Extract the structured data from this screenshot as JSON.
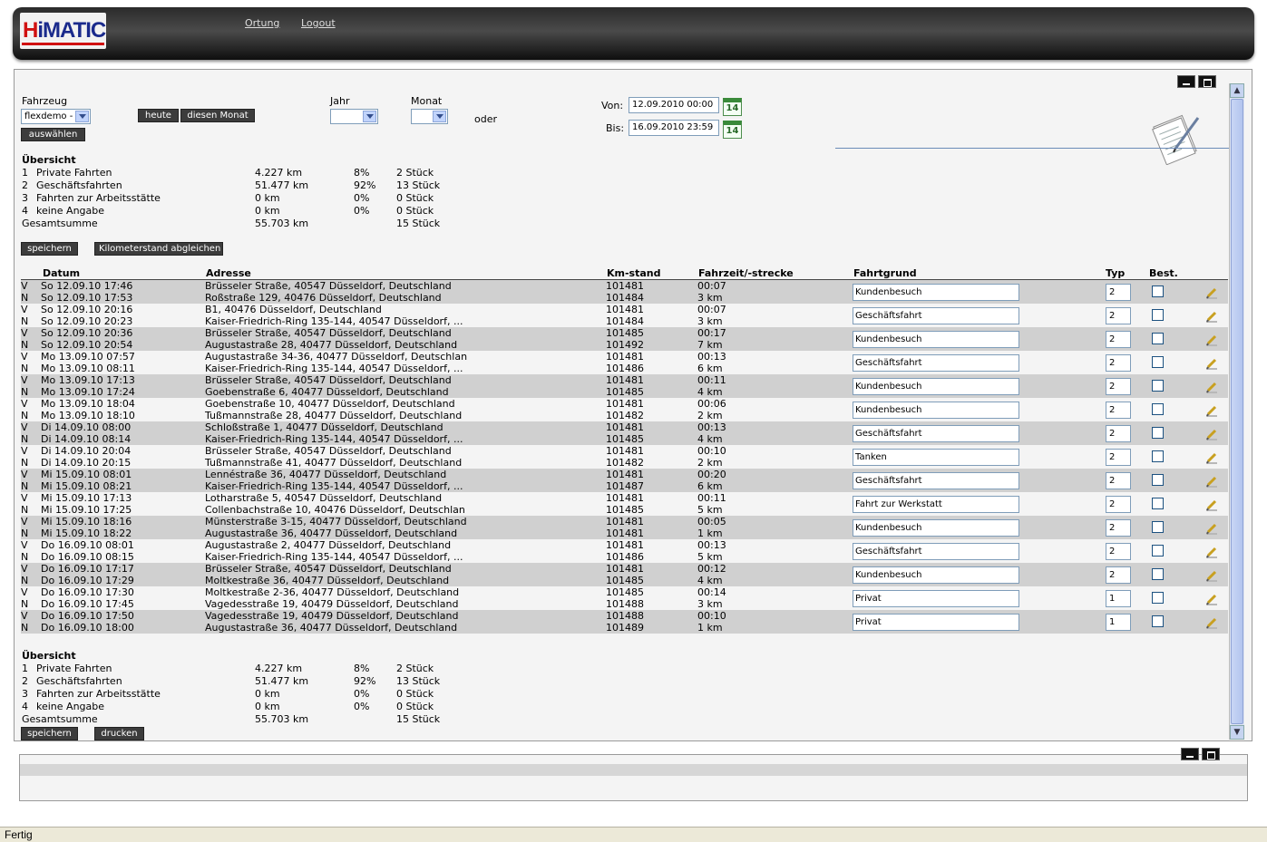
{
  "header": {
    "logo_text": "HiMATIC",
    "nav": [
      "Ortung",
      "Logout"
    ]
  },
  "filter": {
    "fahrzeug_label": "Fahrzeug",
    "fahrzeug_value": "flexdemo -",
    "auswaehlen": "auswählen",
    "heute": "heute",
    "diesen_monat": "diesen Monat",
    "jahr_label": "Jahr",
    "monat_label": "Monat",
    "oder": "oder",
    "von_label": "Von:",
    "von_value": "12.09.2010 00:00",
    "bis_label": "Bis:",
    "bis_value": "16.09.2010 23:59",
    "calendar_day": "14"
  },
  "overview": {
    "title": "Übersicht",
    "rows": [
      {
        "nr": "1",
        "name": "Private Fahrten",
        "km": "4.227 km",
        "pct": "8%",
        "count": "2 Stück"
      },
      {
        "nr": "2",
        "name": "Geschäftsfahrten",
        "km": "51.477 km",
        "pct": "92%",
        "count": "13 Stück"
      },
      {
        "nr": "3",
        "name": "Fahrten zur Arbeitsstätte",
        "km": "0 km",
        "pct": "0%",
        "count": "0 Stück"
      },
      {
        "nr": "4",
        "name": "keine Angabe",
        "km": "0 km",
        "pct": "0%",
        "count": "0 Stück"
      }
    ],
    "total_label": "Gesamtsumme",
    "total_km": "55.703 km",
    "total_count": "15 Stück"
  },
  "buttons": {
    "speichern": "speichern",
    "km_abgleichen": "Kilometerstand abgleichen",
    "drucken": "drucken"
  },
  "table": {
    "headers": {
      "datum": "Datum",
      "adresse": "Adresse",
      "kmstand": "Km-stand",
      "fahrzeit": "Fahrzeit/-strecke",
      "fahrtgrund": "Fahrtgrund",
      "typ": "Typ",
      "best": "Best."
    },
    "trips": [
      {
        "v": {
          "flag": "V",
          "date": "So  12.09.10   17:46",
          "addr": "Brüsseler Straße, 40547 Düsseldorf, Deutschland",
          "km": "101481",
          "time": "00:07"
        },
        "n": {
          "flag": "N",
          "date": "So 12.09.10   17:53",
          "addr": "Roßstraße 129, 40476 Düsseldorf, Deutschland",
          "km": "101484",
          "time": "3 km"
        },
        "grund": "Kundenbesuch",
        "typ": "2"
      },
      {
        "v": {
          "flag": "V",
          "date": "So  12.09.10   20:16",
          "addr": "B1, 40476 Düsseldorf, Deutschland",
          "km": "101481",
          "time": "00:07"
        },
        "n": {
          "flag": "N",
          "date": "So 12.09.10   20:23",
          "addr": "Kaiser-Friedrich-Ring 135-144, 40547 Düsseldorf, ...",
          "km": "101484",
          "time": "3 km"
        },
        "grund": "Geschäftsfahrt",
        "typ": "2"
      },
      {
        "v": {
          "flag": "V",
          "date": "So  12.09.10   20:36",
          "addr": "Brüsseler Straße, 40547 Düsseldorf, Deutschland",
          "km": "101485",
          "time": "00:17"
        },
        "n": {
          "flag": "N",
          "date": "So 12.09.10   20:54",
          "addr": "Augustastraße 28, 40477 Düsseldorf, Deutschland",
          "km": "101492",
          "time": "7 km"
        },
        "grund": "Kundenbesuch",
        "typ": "2"
      },
      {
        "v": {
          "flag": "V",
          "date": "Mo  13.09.10   07:57",
          "addr": "Augustastraße 34-36, 40477 Düsseldorf, Deutschlan",
          "km": "101481",
          "time": "00:13"
        },
        "n": {
          "flag": "N",
          "date": "Mo 13.09.10   08:11",
          "addr": "Kaiser-Friedrich-Ring 135-144, 40547 Düsseldorf, ...",
          "km": "101486",
          "time": "6 km"
        },
        "grund": "Geschäftsfahrt",
        "typ": "2"
      },
      {
        "v": {
          "flag": "V",
          "date": "Mo  13.09.10   17:13",
          "addr": "Brüsseler Straße, 40547 Düsseldorf, Deutschland",
          "km": "101481",
          "time": "00:11"
        },
        "n": {
          "flag": "N",
          "date": "Mo 13.09.10   17:24",
          "addr": "Goebenstraße 6, 40477 Düsseldorf, Deutschland",
          "km": "101485",
          "time": "4 km"
        },
        "grund": "Kundenbesuch",
        "typ": "2"
      },
      {
        "v": {
          "flag": "V",
          "date": "Mo  13.09.10   18:04",
          "addr": "Goebenstraße 10, 40477 Düsseldorf, Deutschland",
          "km": "101481",
          "time": "00:06"
        },
        "n": {
          "flag": "N",
          "date": "Mo 13.09.10   18:10",
          "addr": "Tußmannstraße 28, 40477 Düsseldorf, Deutschland",
          "km": "101482",
          "time": "2 km"
        },
        "grund": "Kundenbesuch",
        "typ": "2"
      },
      {
        "v": {
          "flag": "V",
          "date": "Di  14.09.10   08:00",
          "addr": "Schloßstraße 1, 40477 Düsseldorf, Deutschland",
          "km": "101481",
          "time": "00:13"
        },
        "n": {
          "flag": "N",
          "date": "Di 14.09.10   08:14",
          "addr": "Kaiser-Friedrich-Ring 135-144, 40547 Düsseldorf, ...",
          "km": "101485",
          "time": "4 km"
        },
        "grund": "Geschäftsfahrt",
        "typ": "2"
      },
      {
        "v": {
          "flag": "V",
          "date": "Di  14.09.10   20:04",
          "addr": "Brüsseler Straße, 40547 Düsseldorf, Deutschland",
          "km": "101481",
          "time": "00:10"
        },
        "n": {
          "flag": "N",
          "date": "Di 14.09.10   20:15",
          "addr": "Tußmannstraße 41, 40477 Düsseldorf, Deutschland",
          "km": "101482",
          "time": "2 km"
        },
        "grund": "Tanken",
        "typ": "2"
      },
      {
        "v": {
          "flag": "V",
          "date": "Mi  15.09.10   08:01",
          "addr": "Lennéstraße 36, 40477 Düsseldorf, Deutschland",
          "km": "101481",
          "time": "00:20"
        },
        "n": {
          "flag": "N",
          "date": "Mi 15.09.10   08:21",
          "addr": "Kaiser-Friedrich-Ring 135-144, 40547 Düsseldorf, ...",
          "km": "101487",
          "time": "6 km"
        },
        "grund": "Geschäftsfahrt",
        "typ": "2"
      },
      {
        "v": {
          "flag": "V",
          "date": "Mi  15.09.10   17:13",
          "addr": "Lotharstraße 5, 40547 Düsseldorf, Deutschland",
          "km": "101481",
          "time": "00:11"
        },
        "n": {
          "flag": "N",
          "date": "Mi 15.09.10   17:25",
          "addr": "Collenbachstraße 10, 40476 Düsseldorf, Deutschlan",
          "km": "101485",
          "time": "5 km"
        },
        "grund": "Fahrt zur Werkstatt",
        "typ": "2"
      },
      {
        "v": {
          "flag": "V",
          "date": "Mi  15.09.10   18:16",
          "addr": "Münsterstraße 3-15, 40477 Düsseldorf, Deutschland",
          "km": "101481",
          "time": "00:05"
        },
        "n": {
          "flag": "N",
          "date": "Mi 15.09.10   18:22",
          "addr": "Augustastraße 36, 40477 Düsseldorf, Deutschland",
          "km": "101481",
          "time": "1 km"
        },
        "grund": "Kundenbesuch",
        "typ": "2"
      },
      {
        "v": {
          "flag": "V",
          "date": "Do  16.09.10   08:01",
          "addr": "Augustastraße 2, 40477 Düsseldorf, Deutschland",
          "km": "101481",
          "time": "00:13"
        },
        "n": {
          "flag": "N",
          "date": "Do 16.09.10   08:15",
          "addr": "Kaiser-Friedrich-Ring 135-144, 40547 Düsseldorf, ...",
          "km": "101486",
          "time": "5 km"
        },
        "grund": "Geschäftsfahrt",
        "typ": "2"
      },
      {
        "v": {
          "flag": "V",
          "date": "Do  16.09.10   17:17",
          "addr": "Brüsseler Straße, 40547 Düsseldorf, Deutschland",
          "km": "101481",
          "time": "00:12"
        },
        "n": {
          "flag": "N",
          "date": "Do 16.09.10   17:29",
          "addr": "Moltkestraße 36, 40477 Düsseldorf, Deutschland",
          "km": "101485",
          "time": "4 km"
        },
        "grund": "Kundenbesuch",
        "typ": "2"
      },
      {
        "v": {
          "flag": "V",
          "date": "Do  16.09.10   17:30",
          "addr": "Moltkestraße 2-36, 40477 Düsseldorf, Deutschland",
          "km": "101485",
          "time": "00:14"
        },
        "n": {
          "flag": "N",
          "date": "Do 16.09.10   17:45",
          "addr": "Vagedesstraße 19, 40479 Düsseldorf, Deutschland",
          "km": "101488",
          "time": "3 km"
        },
        "grund": "Privat",
        "typ": "1"
      },
      {
        "v": {
          "flag": "V",
          "date": "Do  16.09.10   17:50",
          "addr": "Vagedesstraße 19, 40479 Düsseldorf, Deutschland",
          "km": "101488",
          "time": "00:10"
        },
        "n": {
          "flag": "N",
          "date": "Do 16.09.10   18:00",
          "addr": "Augustastraße 36, 40477 Düsseldorf, Deutschland",
          "km": "101489",
          "time": "1 km"
        },
        "grund": "Privat",
        "typ": "1"
      }
    ]
  },
  "statusbar": {
    "text": "Fertig"
  }
}
